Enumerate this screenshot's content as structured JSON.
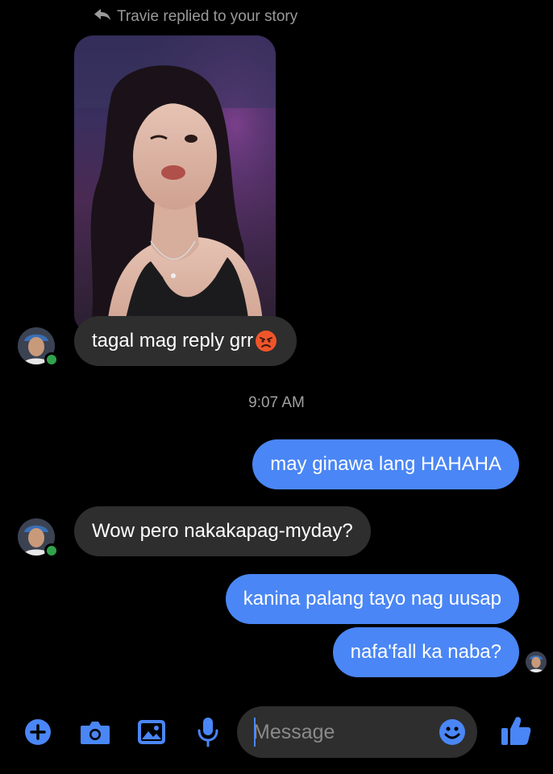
{
  "story_reply": {
    "header": "Travie replied to your story",
    "reply_text": "tagal mag reply grr",
    "reaction_emoji": "😡"
  },
  "timestamp": "9:07 AM",
  "messages": [
    {
      "from": "me",
      "text": "may ginawa lang HAHAHA"
    },
    {
      "from": "contact",
      "text": "Wow pero nakakapag-myday?"
    },
    {
      "from": "me",
      "text": "kanina palang tayo nag uusap"
    },
    {
      "from": "me",
      "text": "nafa'fall ka naba?"
    }
  ],
  "composer": {
    "placeholder": "Message"
  },
  "icons": {
    "reply": "reply-arrow-icon",
    "add": "plus-circle-icon",
    "camera": "camera-icon",
    "gallery": "image-icon",
    "mic": "microphone-icon",
    "emoji": "smiley-icon",
    "like": "thumbs-up-icon"
  },
  "colors": {
    "outgoing_bubble": "#4a86f5",
    "incoming_bubble": "#2e2e2e",
    "accent": "#4a86f5",
    "online": "#31a24c",
    "background": "#000000"
  }
}
